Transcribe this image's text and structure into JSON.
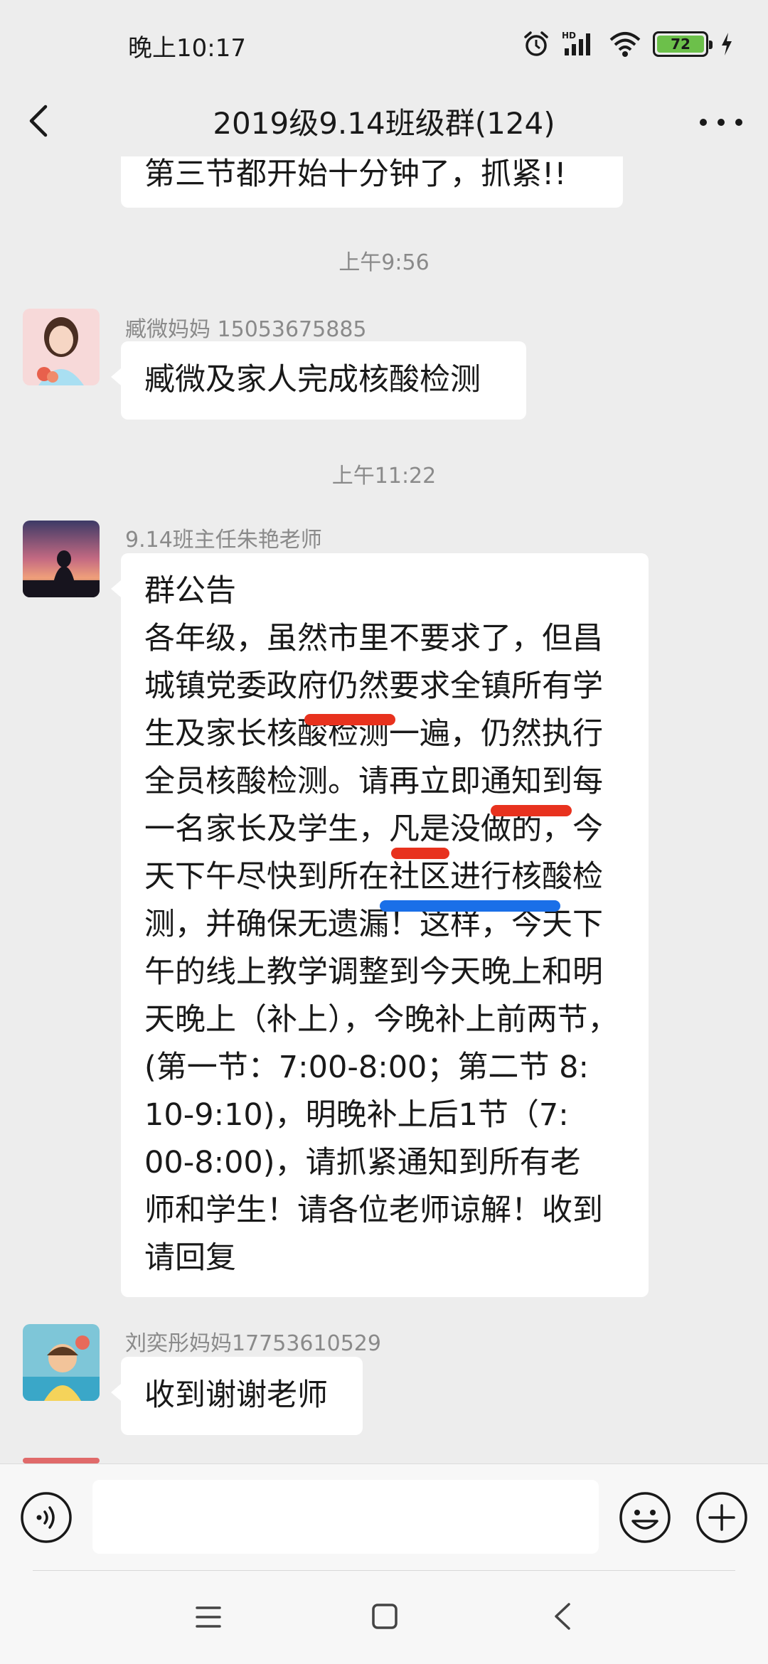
{
  "status_bar": {
    "time": "晚上10:17",
    "network_badge": "HD",
    "battery_level": "72"
  },
  "header": {
    "title": "2019级9.14班级群(124)"
  },
  "messages": [
    {
      "type": "partial",
      "lines": [
        "第三节都开始十分钟了，抓紧!!"
      ]
    },
    {
      "type": "timestamp",
      "text": "上午9:56"
    },
    {
      "type": "message",
      "sender": "臧微妈妈 15053675885",
      "lines": [
        "臧微及家人完成核酸检测"
      ]
    },
    {
      "type": "timestamp",
      "text": "上午11:22"
    },
    {
      "type": "message",
      "sender": "9.14班主任朱艳老师",
      "lines": [
        "群公告",
        "各年级，虽然市里不要求了，但昌",
        "城镇党委政府仍然要求全镇所有学",
        "生及家长核酸检测一遍，仍然执行",
        "全员核酸检测。请再立即通知到每",
        "一名家长及学生，凡是没做的，今",
        "天下午尽快到所在社区进行核酸检",
        "测，并确保无遗漏！这样，今天下",
        "午的线上教学调整到今天晚上和明",
        "天晚上（补上），今晚补上前两节，",
        "(第一节：7:00-8:00；第二节 8:",
        "10-9:10)，明晚补上后1节（7:",
        "00-8:00)，请抓紧通知到所有老",
        "师和学生！请各位老师谅解！收到",
        "请回复"
      ]
    },
    {
      "type": "message",
      "sender": "刘奕彤妈妈17753610529",
      "lines": [
        "收到谢谢老师"
      ]
    }
  ],
  "colors": {
    "background": "#ededed",
    "bubble": "#ffffff",
    "highlight_red": "#e8321e",
    "highlight_blue": "#1a6fe8",
    "battery_green": "#6cc04a"
  },
  "input": {
    "placeholder": ""
  },
  "icons": {
    "status": [
      "alarm-icon",
      "signal-icon",
      "wifi-icon",
      "battery-icon",
      "charging-icon"
    ],
    "header": [
      "back-icon",
      "more-icon"
    ],
    "input": [
      "voice-icon",
      "emoji-icon",
      "plus-icon"
    ],
    "nav": [
      "menu-icon",
      "home-icon",
      "back-nav-icon"
    ]
  }
}
